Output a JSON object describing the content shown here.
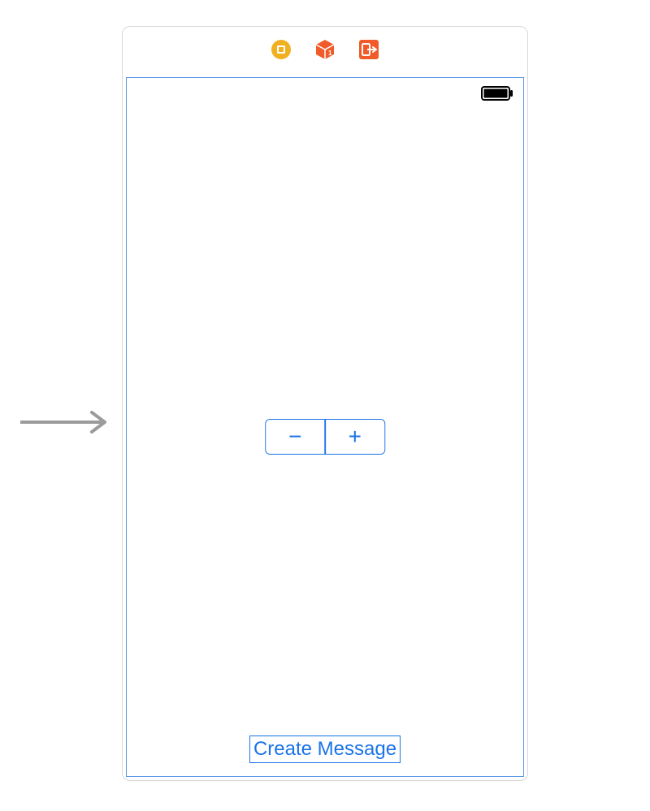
{
  "toolbar": {
    "icons": {
      "processor": "processor-icon",
      "cube": "cube-icon",
      "exit": "exit-icon"
    },
    "colors": {
      "gold": "#f0b020",
      "orange": "#f15a29"
    }
  },
  "screen": {
    "stepper": {
      "minus": "−",
      "plus": "+"
    },
    "create_button_label": "Create Message"
  },
  "colors": {
    "ib_blue": "#1a73e8",
    "selection_blue": "#5c9ae8",
    "arrow_gray": "#9b9b9b"
  }
}
